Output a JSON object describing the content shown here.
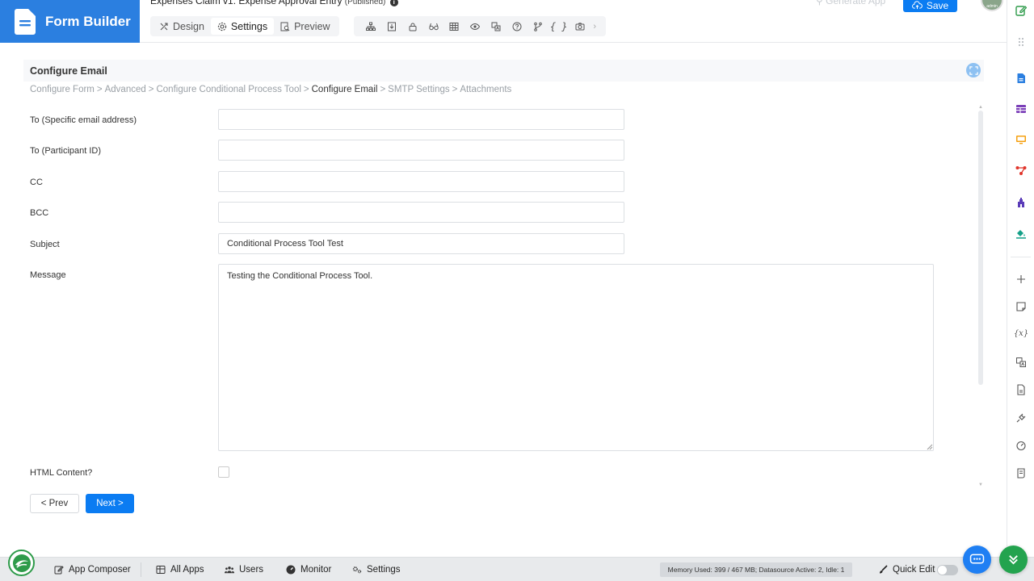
{
  "app": {
    "title": "Form Builder",
    "form_name": "Expenses Claim v1: Expense Approval Entry",
    "form_status": "(Published)",
    "info_glyph": "i"
  },
  "tabs": [
    {
      "label": "Design",
      "icon": "design-icon"
    },
    {
      "label": "Settings",
      "icon": "gear-icon",
      "active": true
    },
    {
      "label": "Preview",
      "icon": "preview-icon"
    }
  ],
  "toolbar": {
    "generate_app_label": "Generate App",
    "save_label": "Save",
    "avatar_text": "admin",
    "code_glyph": "{ }",
    "more_glyph": "›"
  },
  "panel": {
    "title": "Configure Email"
  },
  "breadcrumb": {
    "items": [
      "Configure Form",
      "Advanced",
      "Configure Conditional Process Tool",
      "Configure Email",
      "SMTP Settings",
      "Attachments"
    ],
    "separator": ">",
    "current_index": 3
  },
  "fields": {
    "to_email": {
      "label": "To (Specific email address)",
      "value": ""
    },
    "to_participant": {
      "label": "To (Participant ID)",
      "value": ""
    },
    "cc": {
      "label": "CC",
      "value": ""
    },
    "bcc": {
      "label": "BCC",
      "value": ""
    },
    "subject": {
      "label": "Subject",
      "value": "Conditional Process Tool Test"
    },
    "message": {
      "label": "Message",
      "value": "Testing the Conditional Process Tool."
    },
    "html_content": {
      "label": "HTML Content?",
      "checked": false
    }
  },
  "nav": {
    "prev_label": "< Prev",
    "next_label": "Next >"
  },
  "rail": {
    "variable_glyph": "{x}"
  },
  "bottombar": {
    "items": [
      "App Composer",
      "All Apps",
      "Users",
      "Monitor",
      "Settings"
    ],
    "memory_text": "Memory Used: 399 / 467 MB; Datasource Active: 2, Idle: 1",
    "quick_edit_label": "Quick Edit",
    "quick_edit_on": false
  },
  "colors": {
    "brand": "#2b7fe0",
    "primary_button": "#0b7cf2",
    "green": "#23a34e"
  }
}
